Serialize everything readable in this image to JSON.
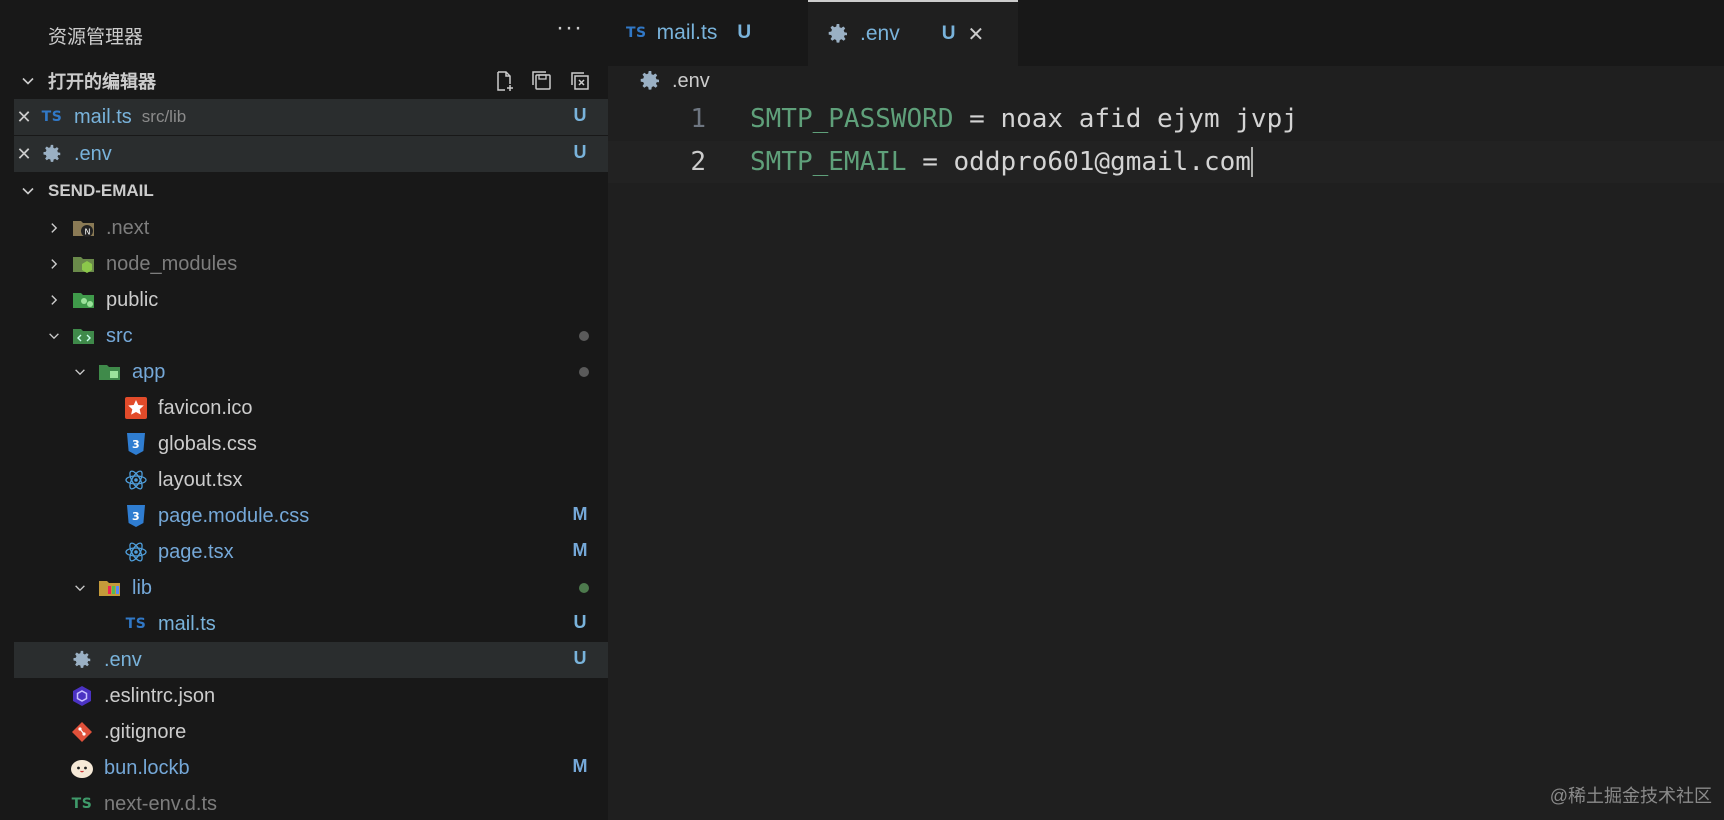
{
  "sidebar": {
    "title": "资源管理器",
    "more": "···",
    "open_editors": {
      "header": "打开的编辑器",
      "items": [
        {
          "ts": "TS",
          "name": "mail.ts",
          "path": "src/lib",
          "badge": "U"
        },
        {
          "name": ".env",
          "badge": "U"
        }
      ]
    },
    "project": {
      "header": "SEND-EMAIL",
      "items": [
        {
          "name": ".next"
        },
        {
          "name": "node_modules"
        },
        {
          "name": "public"
        },
        {
          "name": "src"
        },
        {
          "name": "app"
        },
        {
          "name": "favicon.ico"
        },
        {
          "name": "globals.css"
        },
        {
          "name": "layout.tsx"
        },
        {
          "name": "page.module.css",
          "badge": "M"
        },
        {
          "name": "page.tsx",
          "badge": "M"
        },
        {
          "name": "lib"
        },
        {
          "ts": "TS",
          "name": "mail.ts",
          "badge": "U"
        },
        {
          "name": ".env",
          "badge": "U"
        },
        {
          "name": ".eslintrc.json"
        },
        {
          "name": ".gitignore"
        },
        {
          "name": "bun.lockb",
          "badge": "M"
        },
        {
          "ts": "TS",
          "name": "next-env.d.ts"
        }
      ]
    }
  },
  "tabs": [
    {
      "ts": "TS",
      "name": "mail.ts",
      "badge": "U"
    },
    {
      "name": ".env",
      "badge": "U",
      "close": "✕"
    }
  ],
  "breadcrumb": ".env",
  "editor": {
    "lines": [
      {
        "num": "1",
        "key": "SMTP_PASSWORD",
        "eq": " = ",
        "value": "noax afid ejym jvpj"
      },
      {
        "num": "2",
        "key": "SMTP_EMAIL",
        "eq": " = ",
        "value": "oddpro601@gmail.com"
      }
    ]
  },
  "watermark": "@稀土掘金技术社区",
  "colors": {
    "accent_ts": "#3178c6",
    "git_untracked": "#79b3db",
    "git_modified": "#75a8d8",
    "env_key": "#5fa07a"
  }
}
